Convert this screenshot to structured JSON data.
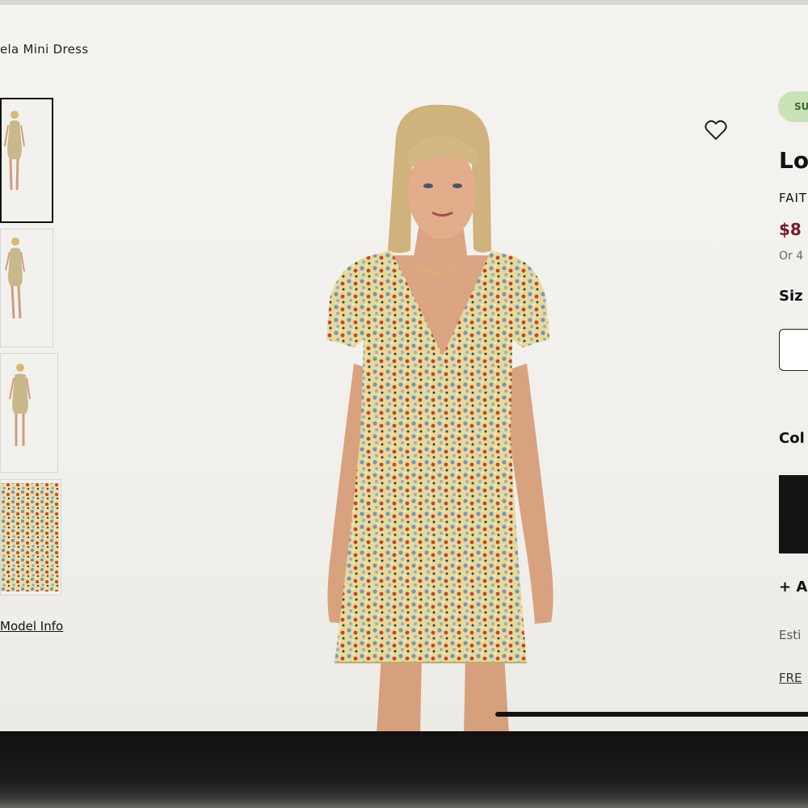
{
  "breadcrumb": {
    "text": "ela Mini Dress"
  },
  "gallery": {
    "thumbnails": [
      {
        "name": "front-view",
        "selected": true
      },
      {
        "name": "side-view",
        "selected": false
      },
      {
        "name": "back-view",
        "selected": false
      },
      {
        "name": "fabric-detail",
        "selected": false
      }
    ],
    "model_info_link": "Model Info"
  },
  "product": {
    "badge": "SU",
    "title": "Lo",
    "brand": "FAIT",
    "price": "$8",
    "installment": "Or 4",
    "size_label": "Siz",
    "color_label": "Col",
    "add_link": "+ A",
    "estimate": "Esti",
    "free_link": "FRE"
  },
  "icons": {
    "wishlist": "heart-outline-icon"
  },
  "colors": {
    "price": "#7a1a2e",
    "badge_bg": "#c9e2b8",
    "badge_text": "#3f6b30",
    "swatch": "#141414"
  }
}
